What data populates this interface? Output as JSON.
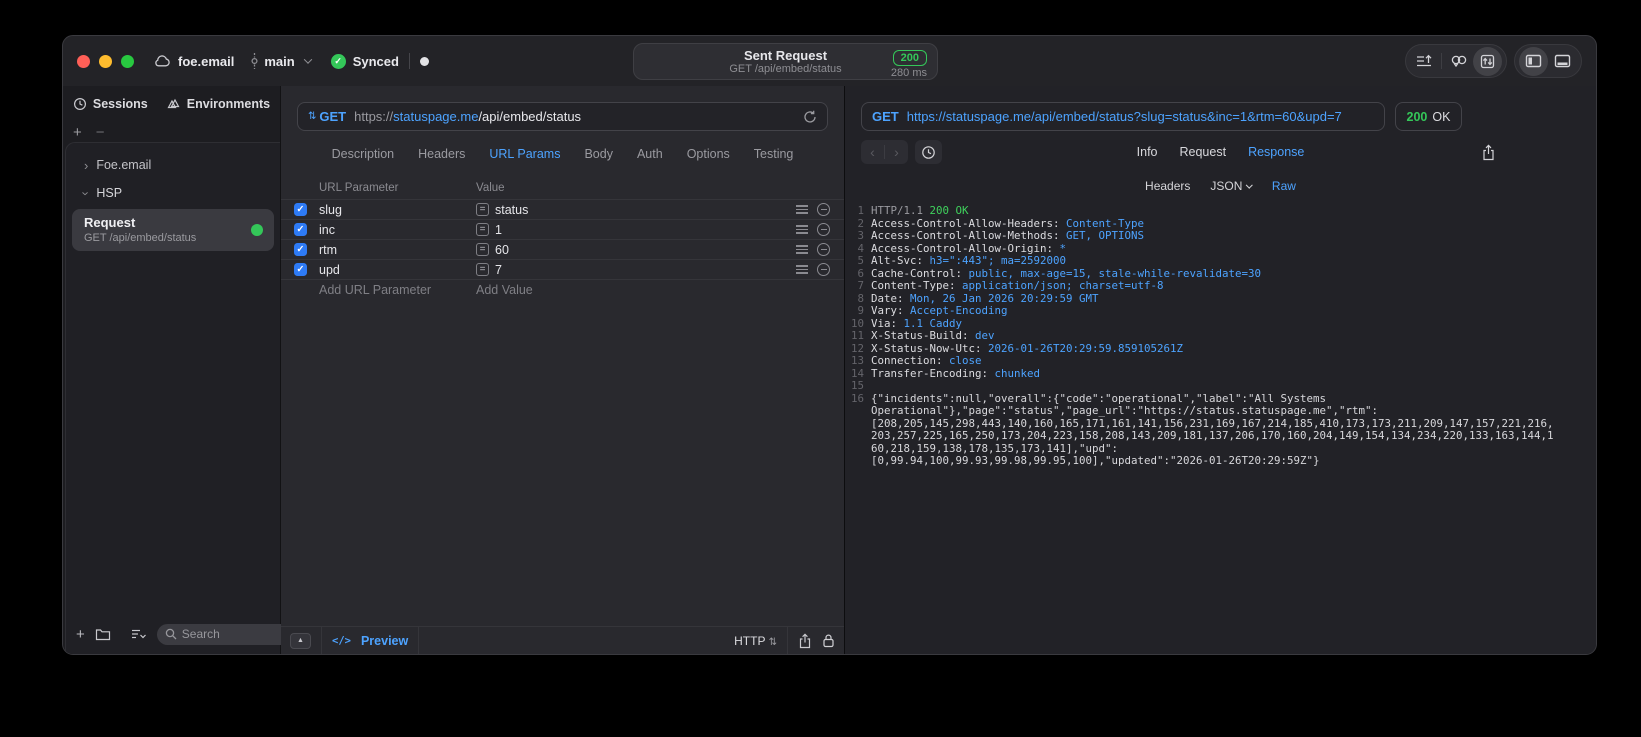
{
  "colors": {
    "accent": "#4da3ff",
    "success": "#34c759",
    "checkbox": "#2e7bf6",
    "badge_green": "#34c759"
  },
  "titlebar": {
    "project": "foe.email",
    "branch": "main",
    "sync_label": "Synced",
    "request_title": "Sent Request",
    "request_subtitle": "GET /api/embed/status",
    "status_code": "200",
    "duration": "280 ms"
  },
  "sidebar": {
    "tabs": [
      {
        "label": "Sessions"
      },
      {
        "label": "Environments"
      }
    ],
    "groups": [
      {
        "label": "Foe.email",
        "expanded": false
      },
      {
        "label": "HSP",
        "expanded": true
      }
    ],
    "request_item": {
      "title": "Request",
      "subtitle": "GET /api/embed/status"
    },
    "search_placeholder": "Search"
  },
  "request_editor": {
    "method": "GET",
    "url": {
      "scheme": "https://",
      "host": "statuspage.me",
      "path": "/api/embed/status"
    },
    "tabs": [
      "Description",
      "Headers",
      "URL Params",
      "Body",
      "Auth",
      "Options",
      "Testing"
    ],
    "active_tab": "URL Params",
    "params": {
      "columns": [
        "URL Parameter",
        "Value"
      ],
      "rows": [
        {
          "checked": true,
          "name": "slug",
          "value": "status"
        },
        {
          "checked": true,
          "name": "inc",
          "value": "1"
        },
        {
          "checked": true,
          "name": "rtm",
          "value": "60"
        },
        {
          "checked": true,
          "name": "upd",
          "value": "7"
        }
      ],
      "add_name": "Add URL Parameter",
      "add_value": "Add Value"
    },
    "footer": {
      "preview": "Preview",
      "code_tag": "</>",
      "protocol": "HTTP"
    }
  },
  "response_viewer": {
    "method": "GET",
    "url": "https://statuspage.me/api/embed/status?slug=status&inc=1&rtm=60&upd=7",
    "status_code": "200",
    "status_text": "OK",
    "tabs": [
      "Info",
      "Request",
      "Response"
    ],
    "active_tab": "Response",
    "subtabs": [
      "Headers",
      "JSON",
      "Raw"
    ],
    "active_subtab": "Raw",
    "raw_lines": [
      {
        "type": "status",
        "protocol": "HTTP/1.1",
        "status": "200 OK"
      },
      {
        "type": "header",
        "name": "Access-Control-Allow-Headers",
        "value": "Content-Type"
      },
      {
        "type": "header",
        "name": "Access-Control-Allow-Methods",
        "value": "GET, OPTIONS"
      },
      {
        "type": "header",
        "name": "Access-Control-Allow-Origin",
        "value": "*"
      },
      {
        "type": "header",
        "name": "Alt-Svc",
        "value": "h3=\":443\"; ma=2592000"
      },
      {
        "type": "header",
        "name": "Cache-Control",
        "value": "public, max-age=15, stale-while-revalidate=30"
      },
      {
        "type": "header",
        "name": "Content-Type",
        "value": "application/json; charset=utf-8"
      },
      {
        "type": "header",
        "name": "Date",
        "value": "Mon, 26 Jan 2026 20:29:59 GMT"
      },
      {
        "type": "header",
        "name": "Vary",
        "value": "Accept-Encoding"
      },
      {
        "type": "header",
        "name": "Via",
        "value": "1.1 Caddy"
      },
      {
        "type": "header",
        "name": "X-Status-Build",
        "value": "dev"
      },
      {
        "type": "header",
        "name": "X-Status-Now-Utc",
        "value": "2026-01-26T20:29:59.859105261Z"
      },
      {
        "type": "header",
        "name": "Connection",
        "value": "close"
      },
      {
        "type": "header",
        "name": "Transfer-Encoding",
        "value": "chunked"
      },
      {
        "type": "blank"
      },
      {
        "type": "body",
        "text": "{\"incidents\":null,\"overall\":{\"code\":\"operational\",\"label\":\"All Systems"
      },
      {
        "type": "body_cont",
        "text": "Operational\"},\"page\":\"status\",\"page_url\":\"https://status.statuspage.me\",\"rtm\":"
      },
      {
        "type": "body_cont",
        "text": "[208,205,145,298,443,140,160,165,171,161,141,156,231,169,167,214,185,410,173,173,211,209,147,157,221,216,"
      },
      {
        "type": "body_cont",
        "text": "203,257,225,165,250,173,204,223,158,208,143,209,181,137,206,170,160,204,149,154,134,234,220,133,163,144,1"
      },
      {
        "type": "body_cont",
        "text": "60,218,159,138,178,135,173,141],\"upd\":"
      },
      {
        "type": "body_cont",
        "text": "[0,99.94,100,99.93,99.98,99.95,100],\"updated\":\"2026-01-26T20:29:59Z\"}"
      }
    ]
  }
}
